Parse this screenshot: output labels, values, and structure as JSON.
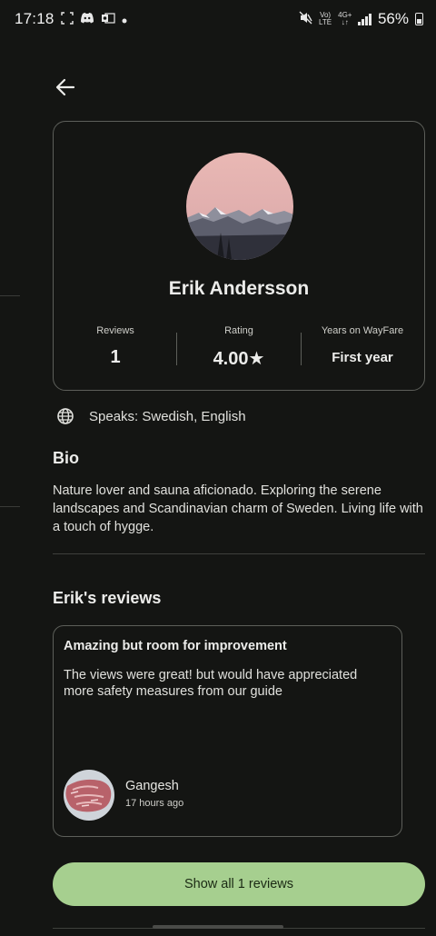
{
  "status_bar": {
    "time": "17:18",
    "battery_percent": "56%",
    "network_top": "Vo)",
    "network_bottom": "LTE",
    "network2_top": "4G+",
    "network2_bottom": "↓↑",
    "notification_icons": [
      "screenshot-icon",
      "discord-icon",
      "outlook-icon",
      "dot-icon"
    ],
    "system_icons": [
      "mute-icon",
      "volte-icon",
      "signal-icon",
      "battery-icon"
    ]
  },
  "header": {
    "back_icon": "arrow-left-icon"
  },
  "profile": {
    "name": "Erik Andersson",
    "avatar": "mountain-landscape-photo",
    "stats": [
      {
        "label": "Reviews",
        "value": "1"
      },
      {
        "label": "Rating",
        "value": "4.00★"
      },
      {
        "label": "Years on WayFare",
        "value": "First year"
      }
    ]
  },
  "speaks": {
    "icon": "globe-icon",
    "text": "Speaks: Swedish, English"
  },
  "bio": {
    "heading": "Bio",
    "text": "Nature lover and sauna aficionado. Exploring the serene landscapes and Scandinavian charm of Sweden. Living life with a touch of hygge."
  },
  "reviews": {
    "heading": "Erik's reviews",
    "items": [
      {
        "title": "Amazing but room for improvement",
        "body": "The views were great! but would have appreciated more safety measures from our guide",
        "reviewer_name": "Gangesh",
        "time_ago": "17 hours ago",
        "reviewer_avatar": "meat-photo"
      }
    ],
    "show_all_label": "Show all 1 reviews"
  },
  "colors": {
    "background": "#141513",
    "card_border": "#5d5f5a",
    "accent_button": "#a6cf8f",
    "text_primary": "#ececea"
  }
}
